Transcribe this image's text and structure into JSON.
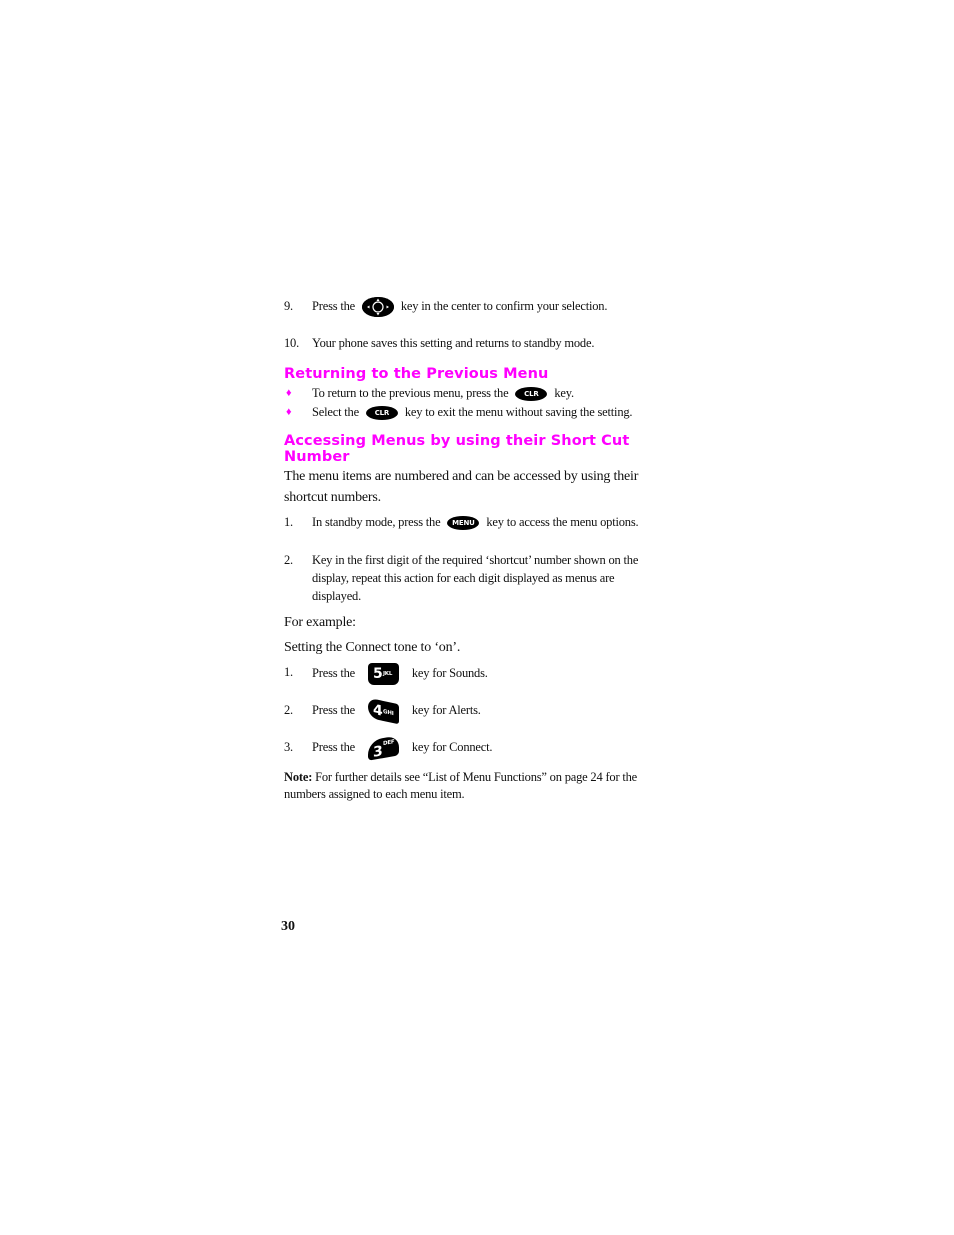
{
  "steps_top": [
    {
      "number": "9.",
      "before": "Press the",
      "key": "nav-center-key",
      "after": "key in the center to confirm your selection."
    },
    {
      "number": "10.",
      "text": "Your phone saves this setting and returns to standby mode."
    }
  ],
  "section_returning": {
    "heading": "Returning to the Previous Menu",
    "bullets": [
      {
        "before": "To return to the previous menu, press the",
        "key_label": "CLR",
        "after": "key."
      },
      {
        "before": "Select the",
        "key_label": "CLR",
        "after": "key to exit the menu without saving the setting."
      }
    ],
    "bullet_glyph": "♦"
  },
  "section_shortcut": {
    "heading_line1": "Accessing Menus by using their Short Cut",
    "heading_line2": "Number",
    "intro_line1": "The menu items are numbered and can be accessed by using their",
    "intro_line2": "shortcut numbers.",
    "steps": [
      {
        "number": "1.",
        "before": "In standby mode, press the",
        "key_label": "MENU",
        "after": "key to access the menu options."
      },
      {
        "number": "2.",
        "text": "Key in the first digit of the required ‘shortcut’ number shown on the display, repeat this action for each digit displayed as menus are displayed."
      }
    ],
    "example_label": "For example:",
    "example_title": "Setting the Connect tone to ‘on’.",
    "example_steps": [
      {
        "number": "1.",
        "before": "Press the",
        "key_digit": "5",
        "key_letters": "JKL",
        "after": "key for Sounds."
      },
      {
        "number": "2.",
        "before": "Press the",
        "key_digit": "4",
        "key_letters": "GHI",
        "after": "key for Alerts."
      },
      {
        "number": "3.",
        "before": "Press the",
        "key_digit": "3",
        "key_letters": "DEF",
        "after": "key for Connect."
      }
    ],
    "note_label": "Note:",
    "note_text": "For further details see “List of Menu Functions” on page 24 for the numbers assigned to each menu item."
  },
  "page_number": "30",
  "colors": {
    "heading": "#ff00ff",
    "bullet": "#ff00ff",
    "key_fill": "#000000"
  }
}
